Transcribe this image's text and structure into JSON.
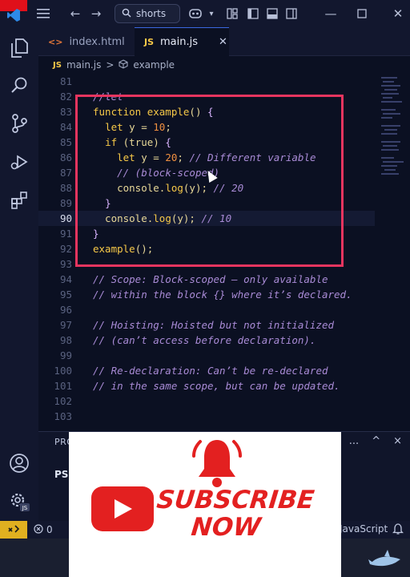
{
  "titlebar": {
    "search_text": "shorts",
    "icons": [
      "vscode-logo-icon",
      "hamburger-menu-icon",
      "back-arrow-icon",
      "forward-arrow-icon",
      "search-icon",
      "copilot-icon",
      "layout-sidebar-icon",
      "layout-panel-icon",
      "layout-split-icon",
      "layout-customize-icon",
      "minimize-icon",
      "maximize-icon",
      "close-icon"
    ]
  },
  "activity_bar": {
    "items": [
      "explorer-icon",
      "search-icon",
      "source-control-icon",
      "run-debug-icon",
      "extensions-icon",
      "account-icon",
      "settings-icon"
    ],
    "settings_badge": "JS"
  },
  "tabs": [
    {
      "label": "index.html",
      "icon_text": "<>",
      "icon_color": "#e8793a",
      "active": false
    },
    {
      "label": "main.js",
      "icon_text": "JS",
      "icon_color": "#f7c948",
      "active": true
    }
  ],
  "breadcrumb": {
    "file_icon": "JS",
    "file": "main.js",
    "separator": ">",
    "symbol": "example"
  },
  "editor": {
    "current_line": 90,
    "lines": [
      {
        "n": "81",
        "tokens": []
      },
      {
        "n": "82",
        "tokens": [
          {
            "c": "cm",
            "t": "//let"
          }
        ]
      },
      {
        "n": "83",
        "tokens": [
          {
            "c": "kw",
            "t": "function "
          },
          {
            "c": "fn",
            "t": "example"
          },
          {
            "c": "pl",
            "t": "() "
          },
          {
            "c": "br",
            "t": "{"
          }
        ]
      },
      {
        "n": "84",
        "tokens": [
          {
            "c": "pl",
            "t": "  "
          },
          {
            "c": "kw",
            "t": "let "
          },
          {
            "c": "pl",
            "t": "y = "
          },
          {
            "c": "nm",
            "t": "10"
          },
          {
            "c": "pl",
            "t": ";"
          }
        ]
      },
      {
        "n": "85",
        "tokens": [
          {
            "c": "pl",
            "t": "  "
          },
          {
            "c": "kw",
            "t": "if "
          },
          {
            "c": "pl",
            "t": "(true) "
          },
          {
            "c": "br",
            "t": "{"
          }
        ]
      },
      {
        "n": "86",
        "tokens": [
          {
            "c": "pl",
            "t": "    "
          },
          {
            "c": "kw",
            "t": "let "
          },
          {
            "c": "pl",
            "t": "y = "
          },
          {
            "c": "nm",
            "t": "20"
          },
          {
            "c": "pl",
            "t": "; "
          },
          {
            "c": "cm",
            "t": "// Different variable"
          }
        ]
      },
      {
        "n": "87",
        "tokens": [
          {
            "c": "pl",
            "t": "    "
          },
          {
            "c": "cm",
            "t": "// (block-scoped)"
          }
        ]
      },
      {
        "n": "88",
        "tokens": [
          {
            "c": "pl",
            "t": "    console."
          },
          {
            "c": "fn",
            "t": "log"
          },
          {
            "c": "pl",
            "t": "(y); "
          },
          {
            "c": "cm",
            "t": "// 20"
          }
        ]
      },
      {
        "n": "89",
        "tokens": [
          {
            "c": "pl",
            "t": "  "
          },
          {
            "c": "br",
            "t": "}"
          }
        ]
      },
      {
        "n": "90",
        "tokens": [
          {
            "c": "pl",
            "t": "  console."
          },
          {
            "c": "fn",
            "t": "log"
          },
          {
            "c": "pl",
            "t": "(y); "
          },
          {
            "c": "cm",
            "t": "// 10"
          }
        ]
      },
      {
        "n": "91",
        "tokens": [
          {
            "c": "br",
            "t": "}"
          }
        ]
      },
      {
        "n": "92",
        "tokens": [
          {
            "c": "fn",
            "t": "example"
          },
          {
            "c": "pl",
            "t": "();"
          }
        ]
      },
      {
        "n": "93",
        "tokens": []
      },
      {
        "n": "94",
        "tokens": [
          {
            "c": "cm",
            "t": "// Scope: Block-scoped — only available"
          }
        ]
      },
      {
        "n": "95",
        "tokens": [
          {
            "c": "cm",
            "t": "// within the block {} where it’s declared."
          }
        ]
      },
      {
        "n": "96",
        "tokens": []
      },
      {
        "n": "97",
        "tokens": [
          {
            "c": "cm",
            "t": "// Hoisting: Hoisted but not initialized"
          }
        ]
      },
      {
        "n": "98",
        "tokens": [
          {
            "c": "cm",
            "t": "// (can’t access before declaration)."
          }
        ]
      },
      {
        "n": "99",
        "tokens": []
      },
      {
        "n": "100",
        "tokens": [
          {
            "c": "cm",
            "t": "// Re-declaration: Can’t be re-declared"
          }
        ]
      },
      {
        "n": "101",
        "tokens": [
          {
            "c": "cm",
            "t": "// in the same scope, but can be updated."
          }
        ]
      },
      {
        "n": "102",
        "tokens": []
      },
      {
        "n": "103",
        "tokens": []
      }
    ]
  },
  "panel": {
    "title": "PRO",
    "terminal_prompt": "PS",
    "actions": [
      "...",
      "^",
      "×"
    ]
  },
  "statusbar": {
    "errors": "0",
    "language": "JavaScript"
  },
  "overlay": {
    "line1": "SUBSCRIBE",
    "line2": "NOW"
  },
  "colors": {
    "accent": "#3a68e0",
    "highlight_box": "#e8355f",
    "subscribe_red": "#e32020",
    "status_remote": "#e0b020"
  }
}
